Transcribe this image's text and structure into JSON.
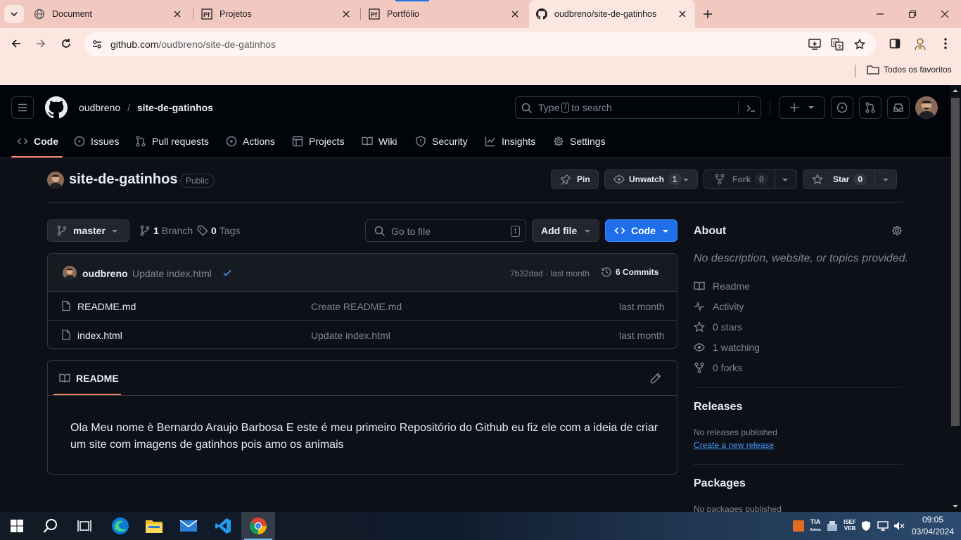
{
  "browser": {
    "tabs": [
      {
        "title": "Document",
        "icon": "globe-icon"
      },
      {
        "title": "Projetos",
        "icon": "pf-icon"
      },
      {
        "title": "Portfólio",
        "icon": "pf-icon"
      },
      {
        "title": "oudbreno/site-de-gatinhos",
        "icon": "github-icon",
        "active": true
      }
    ],
    "url_host": "github.com",
    "url_path": "/oudbreno/site-de-gatinhos",
    "bookmarks_label": "Todos os favoritos"
  },
  "header": {
    "owner": "oudbreno",
    "separator": "/",
    "repo": "site-de-gatinhos",
    "search_prefix": "Type",
    "search_key": "/",
    "search_suffix": "to search"
  },
  "nav": [
    {
      "label": "Code",
      "icon": "code-icon",
      "selected": true
    },
    {
      "label": "Issues",
      "icon": "issue-icon"
    },
    {
      "label": "Pull requests",
      "icon": "pull-request-icon"
    },
    {
      "label": "Actions",
      "icon": "play-icon"
    },
    {
      "label": "Projects",
      "icon": "table-icon"
    },
    {
      "label": "Wiki",
      "icon": "book-icon"
    },
    {
      "label": "Security",
      "icon": "shield-icon"
    },
    {
      "label": "Insights",
      "icon": "graph-icon"
    },
    {
      "label": "Settings",
      "icon": "gear-icon"
    }
  ],
  "repo": {
    "name": "site-de-gatinhos",
    "visibility": "Public",
    "pin_label": "Pin",
    "unwatch_label": "Unwatch",
    "watch_count": "1",
    "fork_label": "Fork",
    "fork_count": "0",
    "star_label": "Star",
    "star_count": "0"
  },
  "filebar": {
    "branch": "master",
    "branch_count": "1",
    "branch_label": "Branch",
    "tag_count": "0",
    "tag_label": "Tags",
    "goto_placeholder": "Go to file",
    "goto_key": "t",
    "add_file_label": "Add file",
    "code_label": "Code"
  },
  "commit": {
    "author": "oudbreno",
    "message": "Update index.html",
    "hash": "7b32dad",
    "sep": "·",
    "time": "last month",
    "commits_label": "6 Commits"
  },
  "files": [
    {
      "name": "README.md",
      "message": "Create README.md",
      "time": "last month"
    },
    {
      "name": "index.html",
      "message": "Update index.html",
      "time": "last month"
    }
  ],
  "readme": {
    "tab_label": "README",
    "text": "Ola Meu nome è Bernardo Araujo Barbosa E este é meu primeiro Repositório do Github eu fiz ele com a ideia de criar um site com imagens de gatinhos pois amo os animais"
  },
  "about": {
    "title": "About",
    "description": "No description, website, or topics provided.",
    "items": [
      {
        "label": "Readme",
        "icon": "book-icon"
      },
      {
        "label": "Activity",
        "icon": "pulse-icon"
      },
      {
        "label": "0 stars",
        "icon": "star-icon"
      },
      {
        "label": "1 watching",
        "icon": "eye-icon"
      },
      {
        "label": "0 forks",
        "icon": "fork-icon"
      }
    ]
  },
  "releases": {
    "title": "Releases",
    "none_text": "No releases published",
    "create_link": "Create a new release"
  },
  "packages": {
    "title": "Packages",
    "none_text": "No packages published"
  },
  "taskbar": {
    "time": "09:05",
    "date": "03/04/2024",
    "tray_labels": [
      "TIA",
      "Admin",
      "ISEF",
      "VEB"
    ]
  },
  "colors": {
    "accent_blue": "#1f6feb",
    "nav_underline": "#f78166",
    "background": "#0d1117"
  }
}
